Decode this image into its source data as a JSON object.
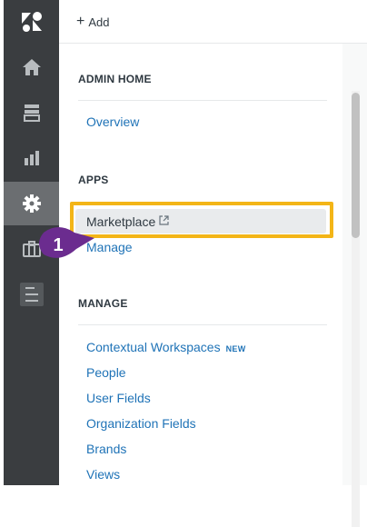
{
  "rail": {
    "items": [
      {
        "icon": "zendesk-logo-icon"
      },
      {
        "icon": "home-icon"
      },
      {
        "icon": "views-icon"
      },
      {
        "icon": "reporting-icon"
      },
      {
        "icon": "admin-gear-icon",
        "active": true
      },
      {
        "icon": "briefcase-icon"
      },
      {
        "icon": "apps-list-icon"
      }
    ]
  },
  "topbar": {
    "add_label": "Add"
  },
  "nav": {
    "admin_home": {
      "title": "ADMIN HOME",
      "items": [
        "Overview"
      ]
    },
    "apps": {
      "title": "APPS",
      "marketplace_label": "Marketplace",
      "manage_label": "Manage"
    },
    "manage": {
      "title": "MANAGE",
      "contextual_label": "Contextual Workspaces",
      "contextual_badge": "NEW",
      "items": [
        "People",
        "User Fields",
        "Organization Fields",
        "Brands",
        "Views"
      ]
    }
  },
  "callout": {
    "number": "1",
    "color": "#6b2c8f",
    "highlight_color": "#f3b517"
  },
  "colors": {
    "rail_bg": "#3a3d40",
    "link": "#1f73b7"
  }
}
